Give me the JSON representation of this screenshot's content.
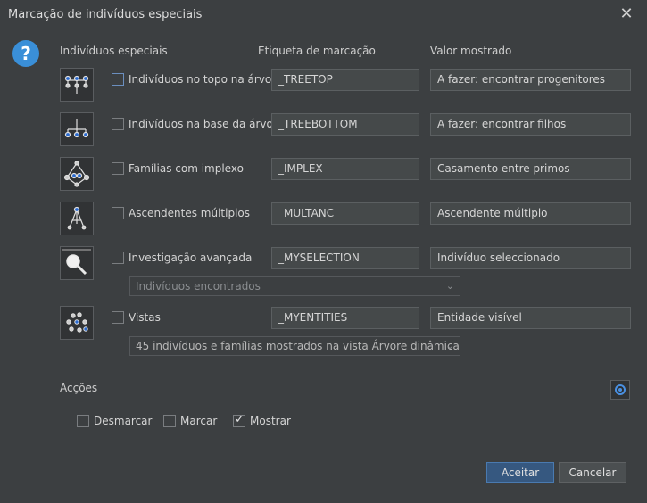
{
  "window": {
    "title": "Marcação de indivíduos especiais"
  },
  "headers": {
    "col1": "Indivíduos especiais",
    "col2": "Etiqueta de marcação",
    "col3": "Valor mostrado"
  },
  "rows": [
    {
      "label": "Indivíduos no topo na árvore",
      "tag": "_TREETOP",
      "value": "A fazer: encontrar progenitores",
      "icon": "tree-top-icon",
      "checked": false
    },
    {
      "label": "Indivíduos na base da árvore",
      "tag": "_TREEBOTTOM",
      "value": "A fazer: encontrar filhos",
      "icon": "tree-bottom-icon",
      "checked": false
    },
    {
      "label": "Famílias com implexo",
      "tag": "_IMPLEX",
      "value": "Casamento entre primos",
      "icon": "implex-icon",
      "checked": false
    },
    {
      "label": "Ascendentes múltiplos",
      "tag": "_MULTANC",
      "value": "Ascendente múltiplo",
      "icon": "multiple-ancestors-icon",
      "checked": false
    },
    {
      "label": "Investigação avançada",
      "tag": "_MYSELECTION",
      "value": "Indivíduo seleccionado",
      "icon": "magnifier-icon",
      "checked": false
    },
    {
      "label": "Vistas",
      "tag": "_MYENTITIES",
      "value": "Entidade visível",
      "icon": "views-icon",
      "checked": false
    }
  ],
  "selects": {
    "search": "Indivíduos encontrados",
    "views": "45 indivíduos e famílias mostrados na vista Árvore dinâmica"
  },
  "actions": {
    "label": "Acções",
    "unmark": "Desmarcar",
    "mark": "Marcar",
    "show": "Mostrar",
    "show_checked": true
  },
  "buttons": {
    "ok": "Aceitar",
    "cancel": "Cancelar"
  },
  "colors": {
    "accent": "#365880",
    "help": "#3a8fd8"
  }
}
